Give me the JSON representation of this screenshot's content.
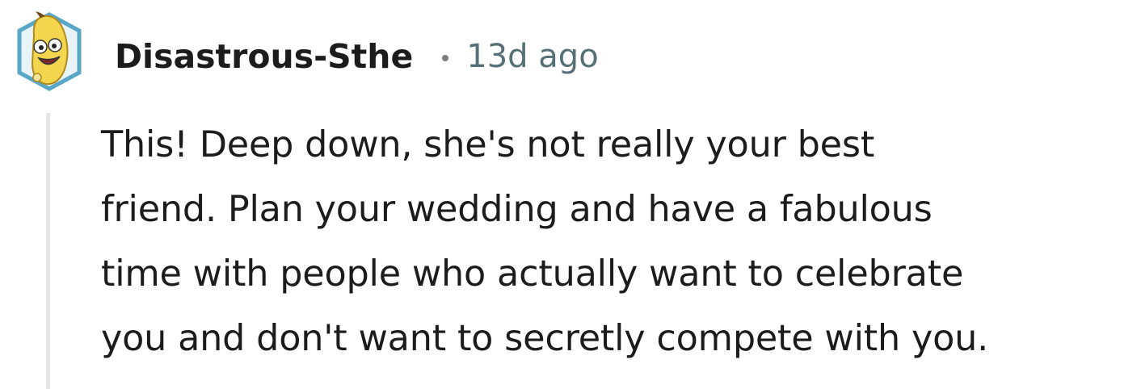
{
  "comment": {
    "username": "Disastrous-Sthe",
    "separator": "•",
    "timestamp": "13d ago",
    "avatar_icon": "banana-snoo-avatar-icon",
    "body_lines": [
      "This! Deep down, she's not really your best",
      "friend. Plan your wedding and have a fabulous",
      "time with people who actually want to celebrate",
      "you and don't want to secretly compete with you."
    ]
  },
  "colors": {
    "username": "#1c1c1c",
    "timestamp": "#576f76",
    "thread_line": "#e5e5e5",
    "avatar_border": "#5aa6c7",
    "avatar_fill": "#f3d54e"
  }
}
